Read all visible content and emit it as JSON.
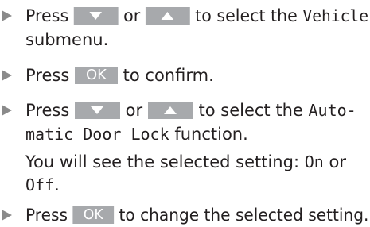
{
  "steps": [
    {
      "word_press": "Press",
      "word_or": "or",
      "text_a": "to select the",
      "mono_a": "Vehicle",
      "text_b": "submenu."
    },
    {
      "word_press": "Press",
      "ok_label": "OK",
      "text_a": "to confirm."
    },
    {
      "word_press": "Press",
      "word_or": "or",
      "text_a": "to select the",
      "mono_a": "Auto-",
      "mono_b": "matic Door Lock",
      "text_b": "function.",
      "note_a": "You will see the selected setting:",
      "note_on": "On",
      "note_or": "or",
      "note_off": "Off",
      "note_end": "."
    },
    {
      "word_press": "Press",
      "ok_label": "OK",
      "text_a": "to change the selected setting."
    }
  ],
  "icons": {
    "bullet": "right-triangle-bullet-icon",
    "down_key": "arrow-down-key-icon",
    "up_key": "arrow-up-key-icon"
  },
  "colors": {
    "text": "#231f20",
    "key_background": "#a7a9ac",
    "bullet": "#8a8a8a"
  }
}
